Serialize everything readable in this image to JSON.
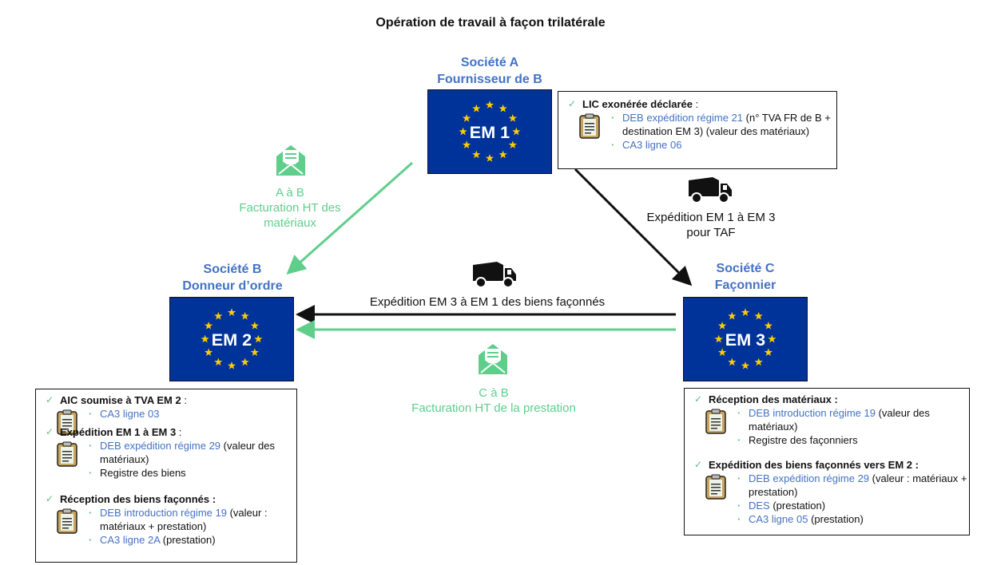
{
  "title": "Opération de travail à façon trilatérale",
  "colors": {
    "eu_blue": "#003399",
    "star": "#ffcc00",
    "company": "#4472c4",
    "invoice_green": "#5fce8b",
    "shipment": "#111111"
  },
  "companies": {
    "a": {
      "name": "Société A",
      "role": "Fournisseur de B",
      "flag_label": "EM 1"
    },
    "b": {
      "name": "Société B",
      "role": "Donneur d’ordre",
      "flag_label": "EM 2"
    },
    "c": {
      "name": "Société C",
      "role": "Façonnier",
      "flag_label": "EM 3"
    }
  },
  "flows": {
    "invoice_ab": {
      "line1": "A à B",
      "line2": "Facturation HT des",
      "line3": "matériaux",
      "icon": "envelope-icon"
    },
    "ship_1_3": {
      "line1": "Expédition EM 1 à EM 3",
      "line2": "pour TAF",
      "icon": "truck-icon"
    },
    "ship_3_1": {
      "line1": "Expédition EM 3 à EM 1 des biens façonnés",
      "icon": "truck-icon"
    },
    "invoice_cb": {
      "line1": "C à B",
      "line2": "Facturation HT de la prestation",
      "icon": "envelope-icon"
    }
  },
  "box_a": {
    "sections": [
      {
        "title": "LIC exonérée déclarée",
        "suffix": " :",
        "items": [
          {
            "link": "DEB expédition régime 21",
            "text": " (n° TVA FR de B + destination EM 3) (valeur des matériaux)"
          },
          {
            "link": "CA3 ligne 06",
            "text": ""
          }
        ]
      }
    ]
  },
  "box_b": {
    "sections": [
      {
        "title": "AIC soumise à TVA EM 2",
        "suffix": " :",
        "items": [
          {
            "link": "CA3 ligne 03",
            "text": ""
          }
        ]
      },
      {
        "title": "Expédition EM 1 à EM 3",
        "suffix": " :",
        "items": [
          {
            "link": "DEB expédition régime 29",
            "text": " (valeur des matériaux)"
          },
          {
            "link": "",
            "text": "Registre des biens"
          }
        ]
      },
      {
        "title": "Réception des biens façonnés :",
        "suffix": "",
        "items": [
          {
            "link": "DEB introduction régime 19",
            "text": " (valeur : matériaux + prestation)"
          },
          {
            "link": "CA3 ligne 2A",
            "text": " (prestation)"
          }
        ]
      }
    ]
  },
  "box_c": {
    "sections": [
      {
        "title": "Réception des matériaux :",
        "suffix": "",
        "items": [
          {
            "link": "DEB introduction régime 19",
            "text": " (valeur des matériaux)"
          },
          {
            "link": "",
            "text": "Registre des façonniers"
          }
        ]
      },
      {
        "title": "Expédition des biens façonnés vers EM 2 :",
        "suffix": "",
        "items": [
          {
            "link": "DEB expédition régime 29",
            "text": " (valeur : matériaux + prestation)"
          },
          {
            "link": "DES",
            "text": " (prestation)"
          },
          {
            "link": "CA3 ligne 05",
            "text": " (prestation)"
          }
        ]
      }
    ]
  }
}
